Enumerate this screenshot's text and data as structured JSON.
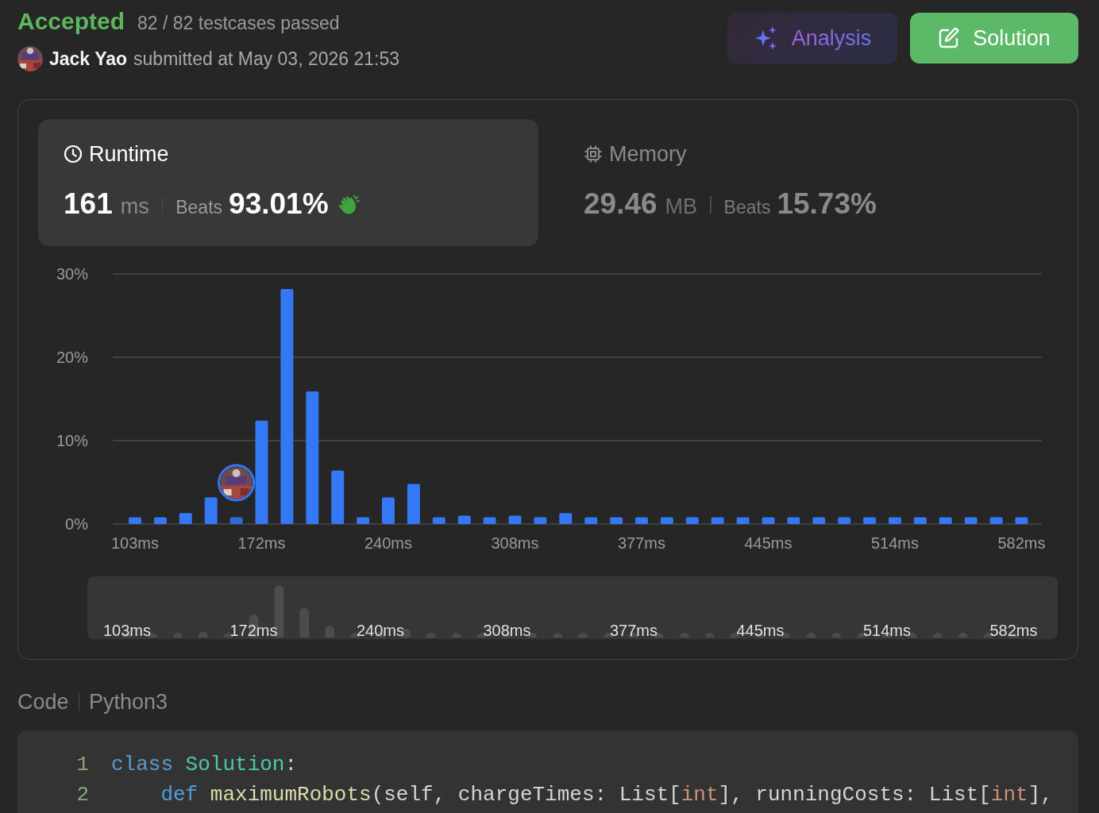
{
  "status": {
    "label": "Accepted",
    "detail": "82 / 82 testcases passed"
  },
  "submission": {
    "author": "Jack Yao",
    "text": "submitted at May 03, 2026 21:53"
  },
  "buttons": [
    {
      "label": "Analysis",
      "kind": "analysis"
    },
    {
      "label": "Solution",
      "kind": "solution"
    }
  ],
  "metrics": [
    {
      "title": "Runtime",
      "kind": "runtime",
      "selected": true,
      "value": "161",
      "unit": "ms",
      "beats_label": "Beats",
      "beats": "93.01%",
      "praise": true
    },
    {
      "title": "Memory",
      "kind": "memory",
      "selected": false,
      "value": "29.46",
      "unit": "MB",
      "beats_label": "Beats",
      "beats": "15.73%",
      "praise": false
    }
  ],
  "chart": {
    "chart_data": {
      "type": "bar",
      "ylim": [
        0,
        30
      ],
      "categories": [
        "103ms",
        null,
        null,
        null,
        null,
        "172ms",
        null,
        null,
        null,
        null,
        "240ms",
        null,
        null,
        null,
        null,
        "308ms",
        null,
        null,
        null,
        null,
        "377ms",
        null,
        null,
        null,
        null,
        "445ms",
        null,
        null,
        null,
        null,
        "514ms",
        null,
        null,
        null,
        null,
        "582ms"
      ],
      "values": [
        0.8,
        0.8,
        1.3,
        3.2,
        0.8,
        12.4,
        28.2,
        15.9,
        6.4,
        0.8,
        3.2,
        4.8,
        0.8,
        1.0,
        0.8,
        1.0,
        0.8,
        1.3,
        0.8,
        0.8,
        0.8,
        0.8,
        0.8,
        0.8,
        0.8,
        0.8,
        0.8,
        0.8,
        0.8,
        0.8,
        0.8,
        0.8,
        0.8,
        0.8,
        0.8,
        0.8
      ],
      "yticks": [
        {
          "value": 0,
          "label": "0%"
        },
        {
          "value": 10,
          "label": "10%"
        },
        {
          "value": 20,
          "label": "20%"
        },
        {
          "value": 30,
          "label": "30%"
        }
      ]
    },
    "bars": [
      {
        "mine": false
      },
      {
        "mine": false
      },
      {
        "mine": false
      },
      {
        "mine": false
      },
      {
        "mine": true
      },
      {
        "mine": false
      },
      {
        "mine": false
      },
      {
        "mine": false
      },
      {
        "mine": false
      },
      {
        "mine": false
      },
      {
        "mine": false
      },
      {
        "mine": false
      },
      {
        "mine": false
      },
      {
        "mine": false
      },
      {
        "mine": false
      },
      {
        "mine": false
      },
      {
        "mine": false
      },
      {
        "mine": false
      },
      {
        "mine": false
      },
      {
        "mine": false
      },
      {
        "mine": false
      },
      {
        "mine": false
      },
      {
        "mine": false
      },
      {
        "mine": false
      },
      {
        "mine": false
      },
      {
        "mine": false
      },
      {
        "mine": false
      },
      {
        "mine": false
      },
      {
        "mine": false
      },
      {
        "mine": false
      },
      {
        "mine": false
      },
      {
        "mine": false
      },
      {
        "mine": false
      },
      {
        "mine": false
      },
      {
        "mine": false
      },
      {
        "mine": false
      }
    ]
  },
  "navigator": {
    "labels": [
      "103ms",
      "172ms",
      "240ms",
      "308ms",
      "377ms",
      "445ms",
      "514ms",
      "582ms"
    ]
  },
  "code": {
    "label": "Code",
    "language": "Python3",
    "lines": [
      {
        "number": "1",
        "tokens": [
          {
            "text": "class",
            "kind": "keyword"
          },
          {
            "text": " Solution",
            "kind": "class"
          },
          {
            "text": ":",
            "kind": "plain"
          }
        ]
      },
      {
        "number": "2",
        "tokens": [
          {
            "text": "    def",
            "kind": "keyword"
          },
          {
            "text": " maximumRobots",
            "kind": "function"
          },
          {
            "text": "(self, chargeTimes: List[",
            "kind": "plain"
          },
          {
            "text": "int",
            "kind": "type"
          },
          {
            "text": "], runningCosts: List[",
            "kind": "plain"
          },
          {
            "text": "int",
            "kind": "type"
          },
          {
            "text": "],",
            "kind": "plain"
          }
        ]
      }
    ]
  }
}
